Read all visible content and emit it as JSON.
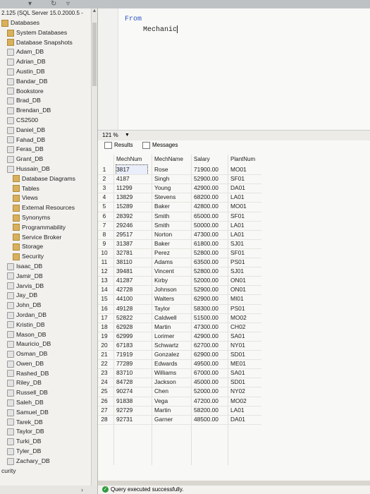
{
  "explorer": {
    "server": "2.125 (SQL Server 15.0.2000.5 -",
    "items": [
      {
        "label": "Databases",
        "kind": "folder",
        "indent": 0
      },
      {
        "label": "System Databases",
        "kind": "folder",
        "indent": 1
      },
      {
        "label": "Database Snapshots",
        "kind": "folder",
        "indent": 1
      },
      {
        "label": "Adam_DB",
        "kind": "db",
        "indent": 1
      },
      {
        "label": "Adrian_DB",
        "kind": "db",
        "indent": 1
      },
      {
        "label": "Austin_DB",
        "kind": "db",
        "indent": 1
      },
      {
        "label": "Bandar_DB",
        "kind": "db",
        "indent": 1
      },
      {
        "label": "Bookstore",
        "kind": "db",
        "indent": 1
      },
      {
        "label": "Brad_DB",
        "kind": "db",
        "indent": 1
      },
      {
        "label": "Brendan_DB",
        "kind": "db",
        "indent": 1
      },
      {
        "label": "CS2500",
        "kind": "db",
        "indent": 1
      },
      {
        "label": "Daniel_DB",
        "kind": "db",
        "indent": 1
      },
      {
        "label": "Fahad_DB",
        "kind": "db",
        "indent": 1
      },
      {
        "label": "Feras_DB",
        "kind": "db",
        "indent": 1
      },
      {
        "label": "Grant_DB",
        "kind": "db",
        "indent": 1
      },
      {
        "label": "Hussain_DB",
        "kind": "db",
        "indent": 1
      },
      {
        "label": "Database Diagrams",
        "kind": "folder",
        "indent": 2
      },
      {
        "label": "Tables",
        "kind": "folder",
        "indent": 2
      },
      {
        "label": "Views",
        "kind": "folder",
        "indent": 2
      },
      {
        "label": "External Resources",
        "kind": "folder",
        "indent": 2
      },
      {
        "label": "Synonyms",
        "kind": "folder",
        "indent": 2
      },
      {
        "label": "Programmability",
        "kind": "folder",
        "indent": 2
      },
      {
        "label": "Service Broker",
        "kind": "folder",
        "indent": 2
      },
      {
        "label": "Storage",
        "kind": "folder",
        "indent": 2
      },
      {
        "label": "Security",
        "kind": "folder",
        "indent": 2
      },
      {
        "label": "Isaac_DB",
        "kind": "db",
        "indent": 1
      },
      {
        "label": "Jamir_DB",
        "kind": "db",
        "indent": 1
      },
      {
        "label": "Jarvis_DB",
        "kind": "db",
        "indent": 1
      },
      {
        "label": "Jay_DB",
        "kind": "db",
        "indent": 1
      },
      {
        "label": "John_DB",
        "kind": "db",
        "indent": 1
      },
      {
        "label": "Jordan_DB",
        "kind": "db",
        "indent": 1
      },
      {
        "label": "Kristin_DB",
        "kind": "db",
        "indent": 1
      },
      {
        "label": "Mason_DB",
        "kind": "db",
        "indent": 1
      },
      {
        "label": "Mauricio_DB",
        "kind": "db",
        "indent": 1
      },
      {
        "label": "Osman_DB",
        "kind": "db",
        "indent": 1
      },
      {
        "label": "Owen_DB",
        "kind": "db",
        "indent": 1
      },
      {
        "label": "Rashed_DB",
        "kind": "db",
        "indent": 1
      },
      {
        "label": "Riley_DB",
        "kind": "db",
        "indent": 1
      },
      {
        "label": "Russell_DB",
        "kind": "db",
        "indent": 1
      },
      {
        "label": "Saleh_DB",
        "kind": "db",
        "indent": 1
      },
      {
        "label": "Samuel_DB",
        "kind": "db",
        "indent": 1
      },
      {
        "label": "Tarek_DB",
        "kind": "db",
        "indent": 1
      },
      {
        "label": "Taylor_DB",
        "kind": "db",
        "indent": 1
      },
      {
        "label": "Turki_DB",
        "kind": "db",
        "indent": 1
      },
      {
        "label": "Tyler_DB",
        "kind": "db",
        "indent": 1
      },
      {
        "label": "Zachary_DB",
        "kind": "db",
        "indent": 1
      },
      {
        "label": "curity",
        "kind": "plain",
        "indent": 0
      }
    ]
  },
  "editor": {
    "keyword": "From",
    "table": "Mechanic"
  },
  "zoom": "121 %",
  "results": {
    "tab_results": "Results",
    "tab_messages": "Messages",
    "columns": [
      "MechNum",
      "MechName",
      "Salary",
      "PlantNum"
    ],
    "rows": [
      [
        "1",
        "3817",
        "Rose",
        "71900.00",
        "MO01"
      ],
      [
        "2",
        "4187",
        "Singh",
        "52900.00",
        "SF01"
      ],
      [
        "3",
        "11299",
        "Young",
        "42900.00",
        "DA01"
      ],
      [
        "4",
        "13829",
        "Stevens",
        "68200.00",
        "LA01"
      ],
      [
        "5",
        "15289",
        "Baker",
        "42800.00",
        "MO01"
      ],
      [
        "6",
        "28392",
        "Smith",
        "65000.00",
        "SF01"
      ],
      [
        "7",
        "29246",
        "Smith",
        "50000.00",
        "LA01"
      ],
      [
        "8",
        "29517",
        "Norton",
        "47300.00",
        "LA01"
      ],
      [
        "9",
        "31387",
        "Baker",
        "61800.00",
        "SJ01"
      ],
      [
        "10",
        "32781",
        "Perez",
        "52800.00",
        "SF01"
      ],
      [
        "11",
        "38110",
        "Adams",
        "63500.00",
        "PS01"
      ],
      [
        "12",
        "39481",
        "Vincent",
        "52800.00",
        "SJ01"
      ],
      [
        "13",
        "41287",
        "Kirby",
        "52000.00",
        "ON01"
      ],
      [
        "14",
        "42728",
        "Johnson",
        "52900.00",
        "ON01"
      ],
      [
        "15",
        "44100",
        "Walters",
        "62900.00",
        "MI01"
      ],
      [
        "16",
        "49128",
        "Taylor",
        "58300.00",
        "PS01"
      ],
      [
        "17",
        "52822",
        "Caldwell",
        "51500.00",
        "MO02"
      ],
      [
        "18",
        "62928",
        "Martin",
        "47300.00",
        "CH02"
      ],
      [
        "19",
        "62999",
        "Lorimer",
        "42900.00",
        "SA01"
      ],
      [
        "20",
        "67183",
        "Schwartz",
        "62700.00",
        "NY01"
      ],
      [
        "21",
        "71919",
        "Gonzalez",
        "62900.00",
        "SD01"
      ],
      [
        "22",
        "77289",
        "Edwards",
        "49500.00",
        "ME01"
      ],
      [
        "23",
        "83710",
        "Williams",
        "67000.00",
        "SA01"
      ],
      [
        "24",
        "84728",
        "Jackson",
        "45000.00",
        "SD01"
      ],
      [
        "25",
        "90274",
        "Chen",
        "52000.00",
        "NY02"
      ],
      [
        "26",
        "91838",
        "Vega",
        "47200.00",
        "MO02"
      ],
      [
        "27",
        "92729",
        "Martin",
        "58200.00",
        "LA01"
      ],
      [
        "28",
        "92731",
        "Garner",
        "48500.00",
        "DA01"
      ]
    ]
  },
  "status": {
    "message": "Query executed successfully."
  },
  "colors": {
    "keyword": "#2a56c6",
    "success": "#2e9a3a"
  }
}
